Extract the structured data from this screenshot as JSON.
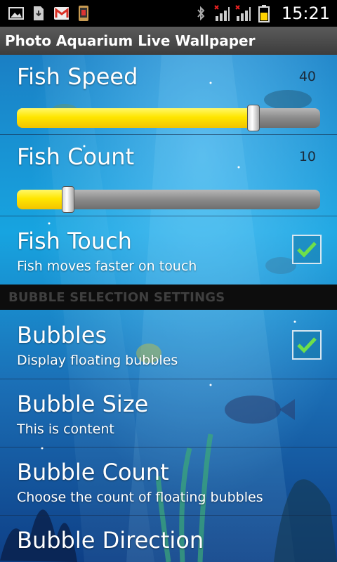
{
  "status_bar": {
    "time": "15:21",
    "icons": [
      "image-icon",
      "download-icon",
      "gmail-icon",
      "phone-icon",
      "bluetooth-icon",
      "signal-no-data-icon",
      "signal-no-data-icon",
      "battery-icon"
    ]
  },
  "app": {
    "title": "Photo Aquarium Live Wallpaper"
  },
  "settings": {
    "fish_speed": {
      "title": "Fish Speed",
      "value": "40",
      "level": 0.78
    },
    "fish_count": {
      "title": "Fish Count",
      "value": "10",
      "level": 0.17
    },
    "fish_touch": {
      "title": "Fish Touch",
      "summary": "Fish moves faster on touch",
      "checked": true
    },
    "section_header": "BUBBLE SELECTION SETTINGS",
    "bubbles": {
      "title": "Bubbles",
      "summary": "Display floating bubbles",
      "checked": true
    },
    "bubble_size": {
      "title": "Bubble Size",
      "summary": "This is content"
    },
    "bubble_count": {
      "title": "Bubble Count",
      "summary": "Choose the count of floating bubbles"
    },
    "bubble_direction": {
      "title": "Bubble Direction"
    }
  },
  "colors": {
    "slider_fill": "#ffe600",
    "check": "#6ee04a",
    "section_bg": "#0d0d0d"
  }
}
